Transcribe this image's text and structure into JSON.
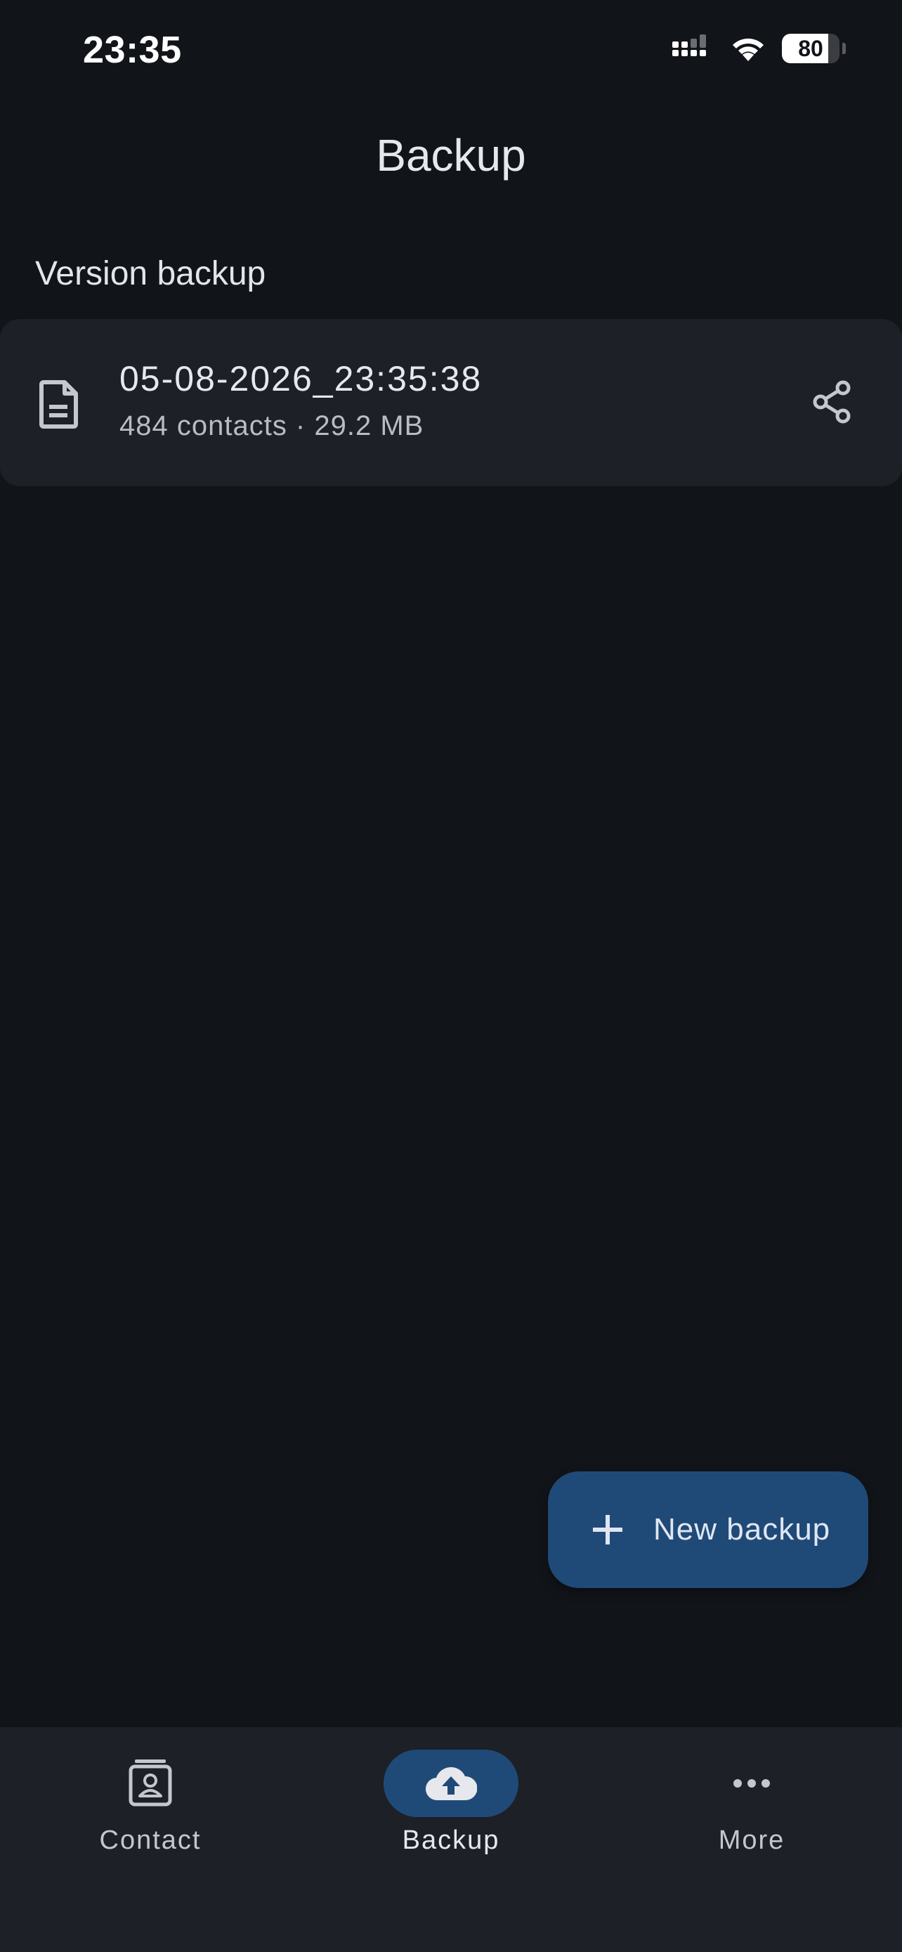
{
  "status_bar": {
    "time": "23:35",
    "battery_level": "80",
    "battery_fraction": 0.8
  },
  "header": {
    "title": "Backup"
  },
  "section": {
    "label": "Version backup"
  },
  "backups": [
    {
      "name": "05-08-2026_23:35:38",
      "meta": "484 contacts · 29.2 MB",
      "icon": "file-document-icon",
      "action_icon": "share-icon"
    }
  ],
  "fab": {
    "label": "New backup",
    "icon": "plus-icon"
  },
  "bottom_nav": {
    "items": [
      {
        "label": "Contact",
        "icon": "contact-card-icon",
        "active": false
      },
      {
        "label": "Backup",
        "icon": "cloud-upload-icon",
        "active": true
      },
      {
        "label": "More",
        "icon": "more-horizontal-icon",
        "active": false
      }
    ]
  },
  "colors": {
    "background": "#111419",
    "surface": "#1d2026",
    "accent": "#1f4a78",
    "text_primary": "#e6e8ed",
    "text_secondary": "#b9bcc4"
  }
}
